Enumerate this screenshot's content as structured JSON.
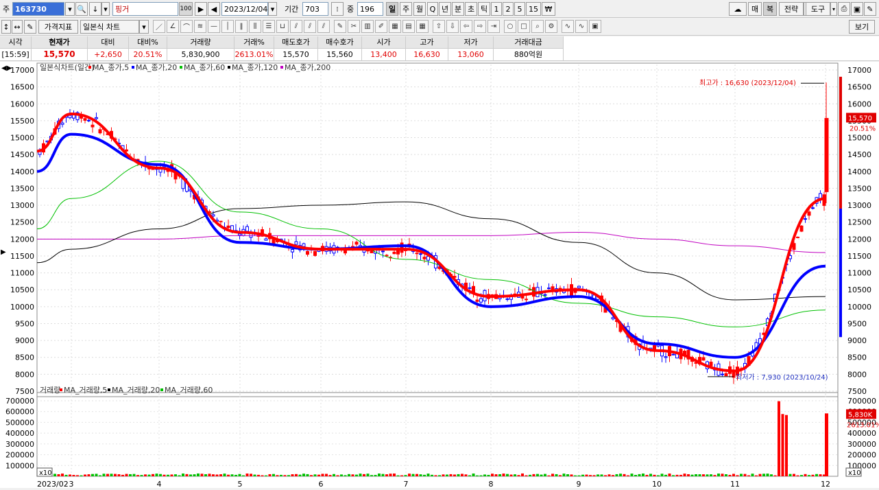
{
  "toolbar1": {
    "market_label": "주",
    "code": "163730",
    "name": "핑거",
    "name_extra": "100",
    "date": "2023/12/04",
    "period_label": "기간",
    "period_value": "703",
    "zoom_label": "중",
    "zoom_value": "196",
    "period_buttons": [
      "일",
      "주",
      "월",
      "Q",
      "년",
      "분",
      "초",
      "틱",
      "1",
      "2",
      "5",
      "15",
      "₩"
    ],
    "right_buttons": [
      "매",
      "복",
      "전략",
      "도구"
    ]
  },
  "toolbar2": {
    "indicator_button": "가격지표",
    "chart_type": "일본식 차트",
    "view_button": "보기"
  },
  "quote": {
    "headers": [
      "시각",
      "현재가",
      "대비",
      "대비%",
      "거래량",
      "거래%",
      "매도호가",
      "매수호가",
      "시가",
      "고가",
      "저가",
      "거래대금"
    ],
    "values": [
      "[15:59]",
      "15,570",
      "+2,650",
      "20.51%",
      "5,830,900",
      "2613.01%",
      "15,570",
      "15,560",
      "13,400",
      "16,630",
      "13,060",
      "880억원"
    ]
  },
  "price_chart": {
    "legend": [
      "일본식차트(일간)",
      "MA_종가,5",
      "MA_종가,20",
      "MA_종가,60",
      "MA_종가,120",
      "MA_종가,200"
    ],
    "y_ticks": [
      "17000",
      "16500",
      "16000",
      "15500",
      "15000",
      "14500",
      "14000",
      "13500",
      "13000",
      "12500",
      "12000",
      "11500",
      "11000",
      "10500",
      "10000",
      "9500",
      "9000",
      "8500",
      "8000",
      "7500"
    ],
    "high_annotation": "최고가 : 16,630 (2023/12/04)",
    "low_annotation": "최저가 : 7,930 (2023/10/24)",
    "last_price_badge": "15,570",
    "last_change_badge": "20.51%",
    "colors": {
      "up": "#ff0000",
      "down": "#0000ff",
      "ma5": "#ff0000",
      "ma20": "#0000ff",
      "ma60": "#00c000",
      "ma120": "#000000",
      "ma200": "#c000c0"
    }
  },
  "volume_chart": {
    "legend": [
      "거래량",
      "MA_거래량,5",
      "MA_거래량,20",
      "MA_거래량,60"
    ],
    "y_ticks": [
      "700000",
      "600000",
      "500000",
      "400000",
      "300000",
      "200000",
      "100000"
    ],
    "scale_label": "x10",
    "last_volume_badge": "5,830K",
    "last_ratio_badge": "2613.01%"
  },
  "x_axis": {
    "labels": [
      "2023/02",
      "3",
      "4",
      "5",
      "6",
      "7",
      "8",
      "9",
      "10",
      "11",
      "12"
    ]
  },
  "chart_data": {
    "type": "line",
    "title": "일본식차트(일간)",
    "x": [
      "2023/02",
      "3",
      "4",
      "5",
      "6",
      "7",
      "8",
      "9",
      "10",
      "11",
      "12"
    ],
    "ylim": [
      7500,
      17000
    ],
    "series": [
      {
        "name": "MA_종가,5",
        "values": [
          14600,
          15700,
          14100,
          12200,
          11700,
          11700,
          10300,
          10500,
          8700,
          8100,
          13200
        ]
      },
      {
        "name": "MA_종가,20",
        "values": [
          14000,
          15100,
          14200,
          11900,
          11700,
          11800,
          10000,
          10300,
          8900,
          8500,
          11200
        ]
      },
      {
        "name": "MA_종가,60",
        "values": [
          12300,
          13200,
          14300,
          12800,
          12300,
          11400,
          10800,
          10100,
          9700,
          9400,
          9900
        ]
      },
      {
        "name": "MA_종가,120",
        "values": [
          11300,
          11700,
          12300,
          12900,
          13000,
          13100,
          12600,
          11900,
          11000,
          10200,
          10300
        ]
      },
      {
        "name": "MA_종가,200",
        "values": [
          12000,
          12000,
          12000,
          12100,
          12100,
          12100,
          12100,
          12200,
          12000,
          11800,
          11600
        ]
      }
    ],
    "highlights": [
      {
        "label": "최고가",
        "value": 16630,
        "date": "2023/12/04"
      },
      {
        "label": "최저가",
        "value": 7930,
        "date": "2023/10/24"
      }
    ]
  }
}
